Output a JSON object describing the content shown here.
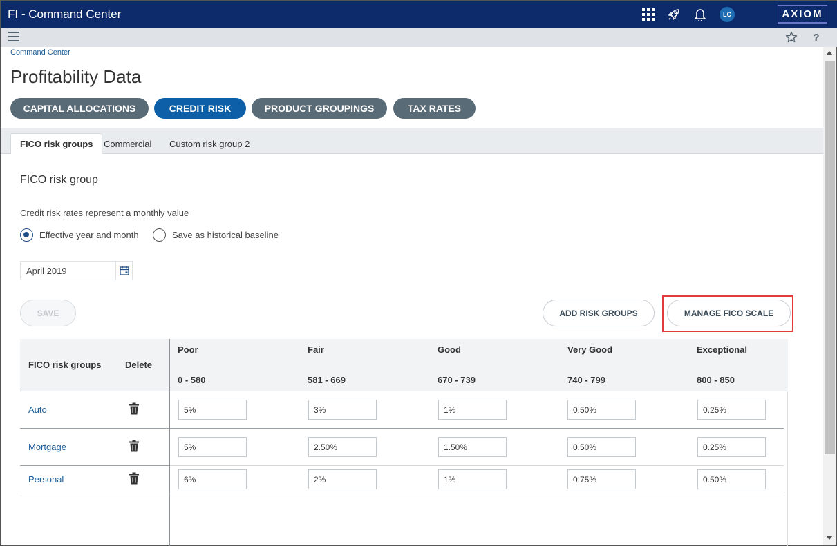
{
  "app": {
    "title": "FI - Command Center",
    "brand": "AXIOM",
    "avatar_initials": "LC",
    "icons": [
      "apps-grid-icon",
      "rocket-icon",
      "bell-icon"
    ]
  },
  "subbar": {
    "icons": [
      "menu-icon",
      "star-icon",
      "help-icon"
    ],
    "help_label": "?"
  },
  "breadcrumb": "Command Center",
  "page_title": "Profitability Data",
  "pills": [
    {
      "label": "CAPITAL ALLOCATIONS",
      "active": false
    },
    {
      "label": "CREDIT RISK",
      "active": true
    },
    {
      "label": "PRODUCT GROUPINGS",
      "active": false
    },
    {
      "label": "TAX RATES",
      "active": false
    }
  ],
  "tabs": [
    {
      "label": "FICO risk groups",
      "active": true
    },
    {
      "label": "Commercial",
      "active": false
    },
    {
      "label": "Custom risk group 2",
      "active": false
    }
  ],
  "section": {
    "title": "FICO risk group",
    "note": "Credit risk rates represent a monthly value"
  },
  "radios": [
    {
      "label": "Effective year and month",
      "checked": true
    },
    {
      "label": "Save as historical baseline",
      "checked": false
    }
  ],
  "date_field": {
    "value": "April 2019"
  },
  "buttons": {
    "save": "SAVE",
    "add_risk_groups": "ADD RISK GROUPS",
    "manage_fico_scale": "MANAGE FICO SCALE"
  },
  "table": {
    "col_groups": "FICO risk groups",
    "col_delete": "Delete",
    "columns": [
      {
        "name": "Poor",
        "range": "0 - 580"
      },
      {
        "name": "Fair",
        "range": "581 - 669"
      },
      {
        "name": "Good",
        "range": "670 - 739"
      },
      {
        "name": "Very Good",
        "range": "740 - 799"
      },
      {
        "name": "Exceptional",
        "range": "800 - 850"
      }
    ],
    "rows": [
      {
        "name": "Auto",
        "values": [
          "5%",
          "3%",
          "1%",
          "0.50%",
          "0.25%"
        ]
      },
      {
        "name": "Mortgage",
        "values": [
          "5%",
          "2.50%",
          "1.50%",
          "0.50%",
          "0.25%"
        ]
      },
      {
        "name": "Personal",
        "values": [
          "6%",
          "2%",
          "1%",
          "0.75%",
          "0.50%"
        ]
      }
    ]
  },
  "colors": {
    "topbar": "#0d2b6a",
    "pill_active": "#0d60a8",
    "pill_inactive": "#5a6b78",
    "link": "#1f5f99",
    "highlight": "#e23b3b"
  }
}
